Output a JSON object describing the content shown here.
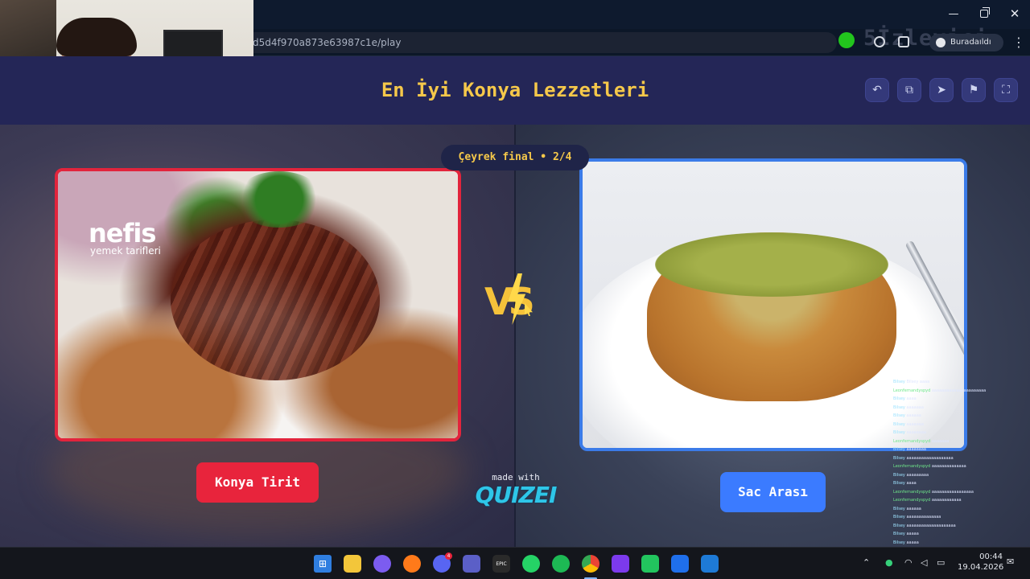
{
  "browser": {
    "url": "d5d4f970a873e63987c1e/play",
    "profile_label": "Buradaıldı",
    "minimize_glyph": "—",
    "close_glyph": "✕",
    "kebab_glyph": "⋮"
  },
  "overlay": {
    "viewer_count_text": "5İzleyici"
  },
  "quiz": {
    "title": "En İyi Konya Lezzetleri",
    "round_label": "Çeyrek final • 2/4",
    "header_buttons": [
      {
        "icon": "undo-icon",
        "glyph": "↶"
      },
      {
        "icon": "share-icon",
        "glyph": "⧉"
      },
      {
        "icon": "send-icon",
        "glyph": "➤"
      },
      {
        "icon": "flag-icon",
        "glyph": "⚑"
      },
      {
        "icon": "fullscreen-icon",
        "glyph": "⛶"
      }
    ],
    "left_option": {
      "label": "Konya Tirit",
      "image_watermark": "nefis",
      "image_watermark_sub": "yemek tarifleri",
      "accent": "#e8243c"
    },
    "right_option": {
      "label": "Sac Arası",
      "accent": "#3b7bff"
    },
    "vs_text": "VS",
    "made_with_text": "made with",
    "brand": "QUIZEI"
  },
  "chat": {
    "lines": [
      {
        "user": "Bilsey",
        "text": "Bilsey aaaa",
        "color": "u1"
      },
      {
        "user": "Leonfernandyspyd",
        "text": "aaaaaaaaaaaaaaaaaaaaaa",
        "color": "u2"
      },
      {
        "user": "Bilsey",
        "text": "aaaa",
        "color": "u1"
      },
      {
        "user": "Bilsey",
        "text": "aaaaaaa",
        "color": "u1"
      },
      {
        "user": "Bilsey",
        "text": "aaaaaa",
        "color": "u1"
      },
      {
        "user": "Bilsey",
        "text": "aaaaaaa",
        "color": "u1"
      },
      {
        "user": "Bilsey",
        "text": "aaaaaaaa",
        "color": "u1"
      },
      {
        "user": "Leonfernandyspyd",
        "text": "aaaaaaa",
        "color": "u2"
      },
      {
        "user": "Bilsey",
        "text": "aaaaaaaa",
        "color": "u1"
      },
      {
        "user": "Bilsey",
        "text": "aaaaaaaaaaaaaaaaaaa",
        "color": "u1"
      },
      {
        "user": "Leonfernandyspyd",
        "text": "aaaaaaaaaaaaaa",
        "color": "u2"
      },
      {
        "user": "Bilsey",
        "text": "aaaaaaaaa",
        "color": "u1"
      },
      {
        "user": "Bilsey",
        "text": "aaaa",
        "color": "u1"
      },
      {
        "user": "Leonfernandyspyd",
        "text": "aaaaaaaaaaaaaaaaa",
        "color": "u2"
      },
      {
        "user": "Leonfernandyspyd",
        "text": "aaaaaaaaaaaa",
        "color": "u2"
      },
      {
        "user": "Bilsey",
        "text": "aaaaaa",
        "color": "u1"
      },
      {
        "user": "Bilsey",
        "text": "aaaaaaaaaaaaaa",
        "color": "u1"
      },
      {
        "user": "Bilsey",
        "text": "aaaaaaaaaaaaaaaaaaaa",
        "color": "u1"
      },
      {
        "user": "Bilsey",
        "text": "aaaaa",
        "color": "u1"
      },
      {
        "user": "Bilsey",
        "text": "aaaaa",
        "color": "u1"
      }
    ]
  },
  "taskbar": {
    "apps": [
      {
        "name": "start-button",
        "glyph": "⊞"
      },
      {
        "name": "file-explorer",
        "glyph": ""
      },
      {
        "name": "copilot",
        "glyph": ""
      },
      {
        "name": "firefox",
        "glyph": ""
      },
      {
        "name": "discord",
        "glyph": ""
      },
      {
        "name": "teams",
        "glyph": ""
      },
      {
        "name": "epic-games",
        "glyph": "EPIC"
      },
      {
        "name": "whatsapp",
        "glyph": ""
      },
      {
        "name": "spotify",
        "glyph": ""
      },
      {
        "name": "chrome",
        "glyph": ""
      },
      {
        "name": "visual-studio",
        "glyph": ""
      },
      {
        "name": "xbox-game-bar",
        "glyph": ""
      },
      {
        "name": "snipping-tool",
        "glyph": ""
      },
      {
        "name": "vscode",
        "glyph": ""
      }
    ],
    "discord_badge": "4",
    "time": "00:44",
    "date": "19.04.2026"
  }
}
